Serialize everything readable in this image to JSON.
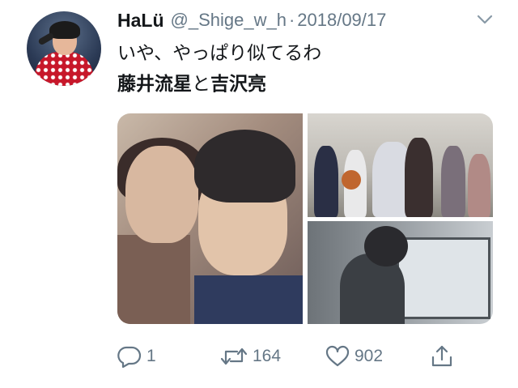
{
  "tweet": {
    "author_name": "HaLü",
    "handle": "@_Shige_w_h",
    "separator": "·",
    "date": "2018/09/17",
    "text_line1": "いや、やっぱり似てるわ",
    "text_line2_name1": "藤井流星",
    "text_line2_joiner": "と",
    "text_line2_name2": "吉沢亮"
  },
  "actions": {
    "reply_count": "1",
    "retweet_count": "164",
    "like_count": "902"
  },
  "colors": {
    "text": "#14171a",
    "muted": "#657786",
    "background": "#ffffff"
  },
  "icons": [
    "reply-icon",
    "retweet-icon",
    "like-icon",
    "share-icon",
    "chevron-down-icon"
  ]
}
